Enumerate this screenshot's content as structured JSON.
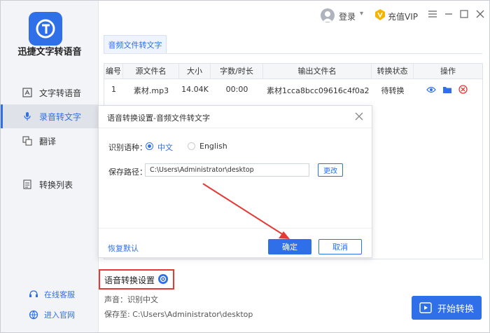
{
  "app": {
    "name": "迅捷文字转语音"
  },
  "sidebar": {
    "items": [
      {
        "label": "文字转语音",
        "icon": "text-to-speech-icon",
        "active": false
      },
      {
        "label": "录音转文字",
        "icon": "microphone-icon",
        "active": true
      },
      {
        "label": "翻译",
        "icon": "translate-icon",
        "active": false
      },
      {
        "label": "转换列表",
        "icon": "conversion-list-icon",
        "active": false
      }
    ],
    "footer": [
      {
        "label": "在线客服",
        "icon": "customer-service-icon"
      },
      {
        "label": "进入官网",
        "icon": "globe-icon"
      }
    ]
  },
  "header": {
    "login": "登录",
    "vip": "充值VIP"
  },
  "tab": {
    "label": "音频文件转文字"
  },
  "table": {
    "columns": [
      "编号",
      "源文件名",
      "大小",
      "字数/时长",
      "输出文件名",
      "转换状态",
      "操作"
    ],
    "rows": [
      {
        "index": "1",
        "source": "素材.mp3",
        "size": "14.04K",
        "duration": "00:00",
        "output": "素材1cca8bcc09616c4f0a2...",
        "status": "待转换"
      }
    ]
  },
  "dialog": {
    "title": "语音转换设置-音频文件转文字",
    "language_label": "识别语种：",
    "lang_options": [
      "中文",
      "English"
    ],
    "selected_language": "中文",
    "path_label": "保存路径：",
    "path_value": "C:\\Users\\Administrator\\desktop",
    "change_label": "更改",
    "reset_label": "恢复默认",
    "ok_label": "确定",
    "cancel_label": "取消"
  },
  "bottom": {
    "settings_label": "语音转换设置",
    "voice_info": "声音：识别中文",
    "save_info": "保存至: C:\\Users\\Administrator\\desktop",
    "start_label": "开始转换"
  },
  "colors": {
    "accent": "#2f6fe8",
    "highlight": "#e53935"
  }
}
